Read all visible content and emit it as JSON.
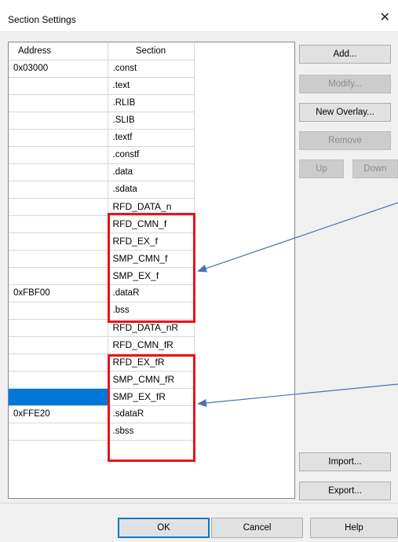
{
  "window": {
    "title": "Section Settings",
    "close_glyph": "✕"
  },
  "table": {
    "headers": {
      "address": "Address",
      "section": "Section"
    },
    "rows": [
      {
        "address": "0x03000",
        "section": ".const"
      },
      {
        "address": "",
        "section": ".text"
      },
      {
        "address": "",
        "section": ".RLIB"
      },
      {
        "address": "",
        "section": ".SLIB"
      },
      {
        "address": "",
        "section": ".textf"
      },
      {
        "address": "",
        "section": ".constf"
      },
      {
        "address": "",
        "section": ".data"
      },
      {
        "address": "",
        "section": ".sdata"
      },
      {
        "address": "",
        "section": "RFD_DATA_n"
      },
      {
        "address": "",
        "section": "RFD_CMN_f"
      },
      {
        "address": "",
        "section": "RFD_EX_f"
      },
      {
        "address": "",
        "section": "SMP_CMN_f"
      },
      {
        "address": "",
        "section": "SMP_EX_f"
      },
      {
        "address": "0xFBF00",
        "section": ".dataR"
      },
      {
        "address": "",
        "section": ".bss"
      },
      {
        "address": "",
        "section": "RFD_DATA_nR"
      },
      {
        "address": "",
        "section": "RFD_CMN_fR"
      },
      {
        "address": "",
        "section": "RFD_EX_fR"
      },
      {
        "address": "",
        "section": "SMP_CMN_fR"
      },
      {
        "address": "",
        "section": "SMP_EX_fR"
      },
      {
        "address": "0xFFE20",
        "section": ".sdataR"
      },
      {
        "address": "",
        "section": ".sbss"
      }
    ],
    "selected_row": 19
  },
  "buttons": {
    "add": "Add...",
    "modify": "Modify...",
    "new_overlay": "New Overlay...",
    "remove": "Remove",
    "up": "Up",
    "down": "Down",
    "import": "Import...",
    "export": "Export...",
    "ok": "OK",
    "cancel": "Cancel",
    "help": "Help"
  },
  "colors": {
    "highlight_box": "#e8141c",
    "arrow": "#4a72b0",
    "selection": "#0078d7"
  }
}
